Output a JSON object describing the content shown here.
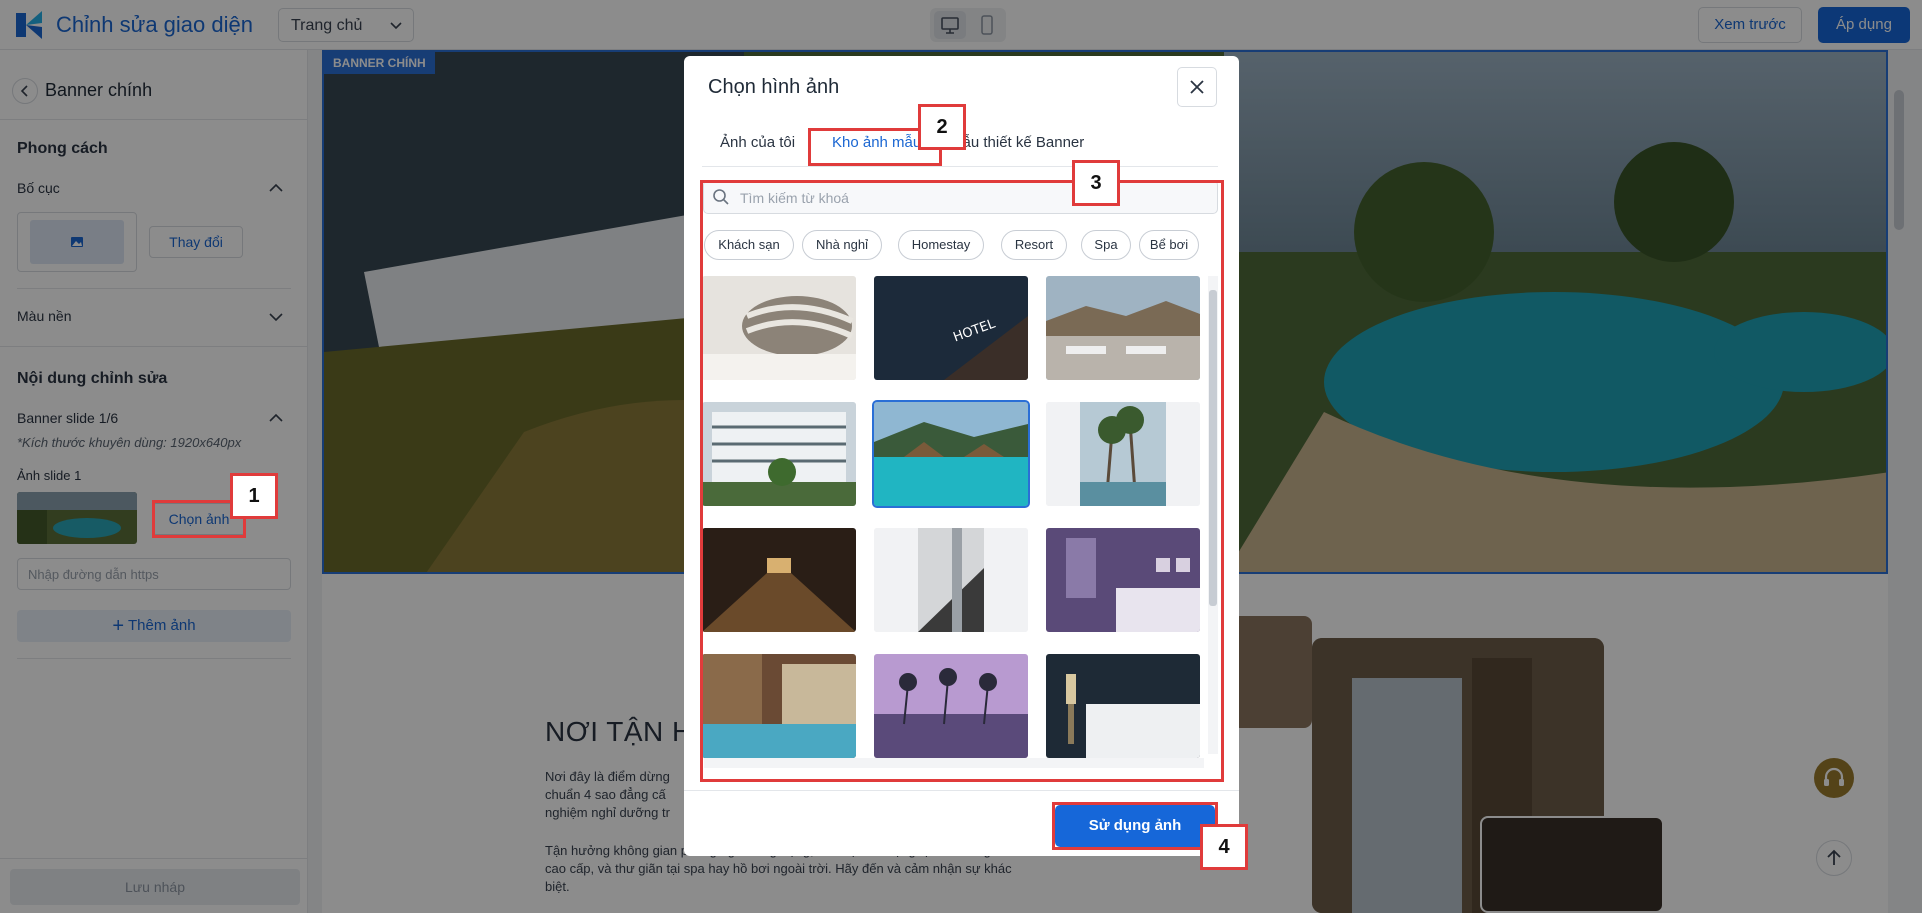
{
  "app": {
    "title": "Chỉnh sửa giao diện",
    "page_select": "Trang chủ"
  },
  "toolbar": {
    "preview_label": "Xem trước",
    "apply_label": "Áp dụng"
  },
  "sidebar": {
    "title": "Banner chính",
    "style_heading": "Phong cách",
    "layout_label": "Bố cục",
    "change_label": "Thay đổi",
    "background_label": "Màu nền",
    "content_heading": "Nội dung chỉnh sửa",
    "slide_label": "Banner slide 1/6",
    "size_hint": "*Kích thước khuyên dùng: 1920x640px",
    "image_label": "Ảnh slide 1",
    "choose_label": "Chọn ảnh",
    "url_placeholder": "Nhập đường dẫn https",
    "add_label": "Thêm ảnh",
    "save_draft_label": "Lưu nháp"
  },
  "canvas": {
    "banner_tag": "BANNER CHÍNH",
    "heading": "NƠI TẬN H",
    "para1": [
      "Nơi đây là điểm dừng",
      "chuẩn 4 sao đẳng cấ",
      "nghiệm nghỉ dưỡng tr"
    ],
    "para2": [
      "Tận hưởng không gian phòng nghỉ sang trọng, ẩm thực đa dạng tại nhà hàng",
      "cao cấp, và thư giãn tại spa hay hồ bơi ngoài trời. Hãy đến và cảm nhận sự khác",
      "biệt."
    ]
  },
  "modal": {
    "title": "Chọn hình ảnh",
    "tabs": [
      {
        "label": "Ảnh của tôi"
      },
      {
        "label": "Kho ảnh mẫu"
      },
      {
        "label": "Mẫu thiết kế Banner"
      }
    ],
    "active_tab": "Kho ảnh mẫu",
    "search_placeholder": "Tìm kiếm từ khoá",
    "chips": [
      "Khách sạn",
      "Nhà nghỉ",
      "Homestay",
      "Resort",
      "Spa",
      "Bể bơi"
    ],
    "images": [
      "pillows",
      "hotel-sign",
      "rooftop-pool",
      "hotel-courtyard",
      "resort-pool",
      "palm-trees",
      "hallway",
      "stairs",
      "purple-bedroom",
      "indoor-pool",
      "sunset-pool",
      "dark-bedroom"
    ],
    "selected_index": 4,
    "use_label": "Sử dụng ảnh"
  },
  "annotations": {
    "n1": "1",
    "n2": "2",
    "n3": "3",
    "n4": "4"
  },
  "colors": {
    "accent": "#1667d9",
    "annotation": "#e03b3b"
  }
}
